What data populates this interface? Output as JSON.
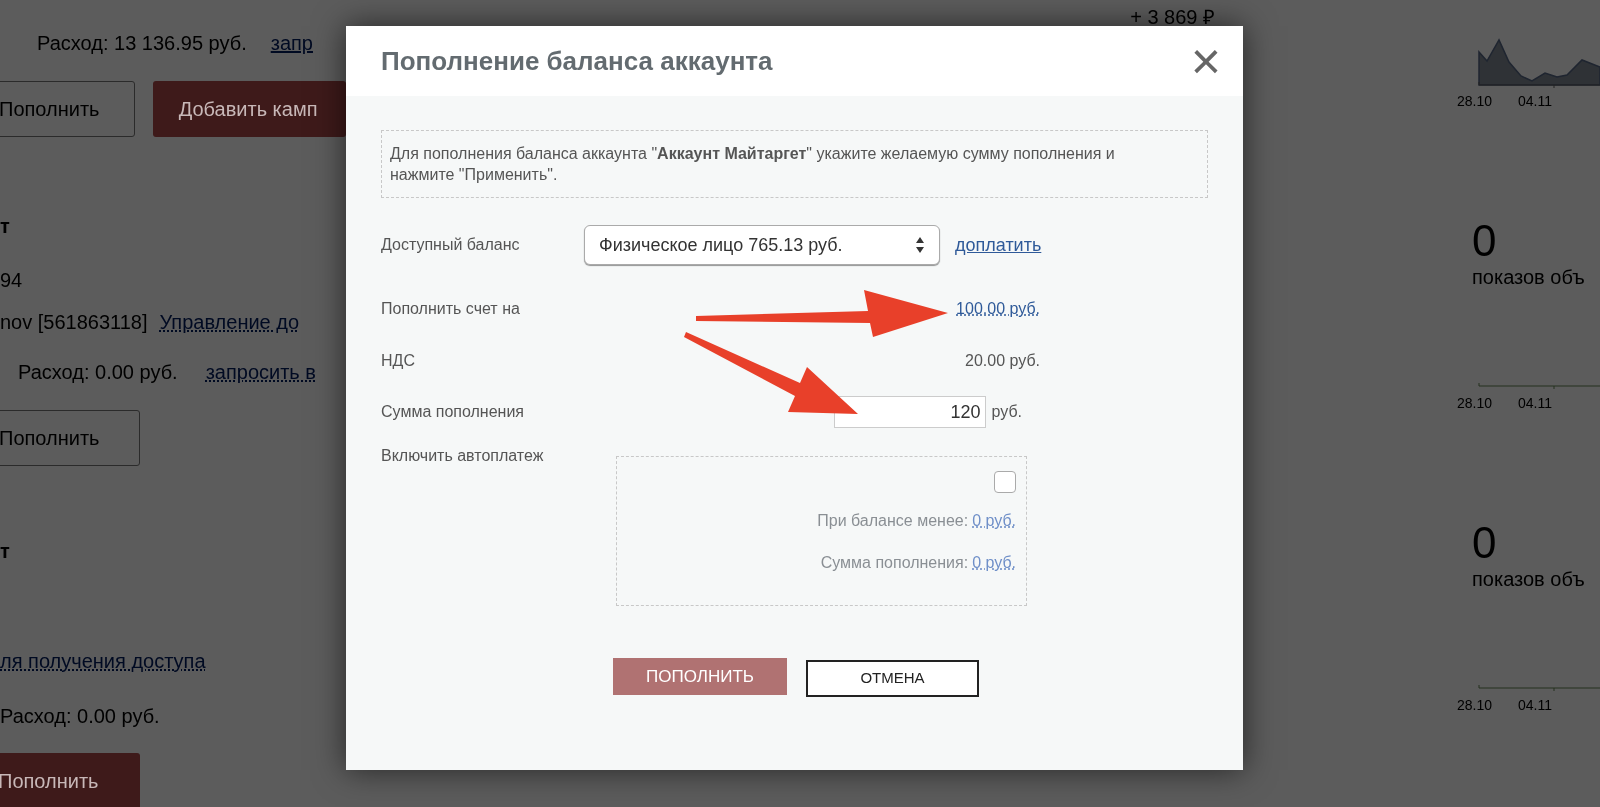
{
  "background": {
    "summary_line": {
      "spend": "Расход: 13 136.95 руб.",
      "link": "запр"
    },
    "top_buttons": {
      "topup": "Пополнить",
      "add_campaign": "Добавить камп"
    },
    "accounts": [
      {
        "heading": "т",
        "id_fragment": "94",
        "owner": "nov [561863118]",
        "manage_link": "Управление до",
        "spend": "Расход: 0.00 руб.",
        "request_link": "запросить в",
        "button": "Пополнить",
        "accent": false
      },
      {
        "heading": "т",
        "access_link": "ля получения доступа",
        "spend": "Расход: 0.00 руб.",
        "button": "Пополнить",
        "accent": true
      }
    ],
    "total": "+ 3 869 ₽",
    "stats": [
      {
        "kind": "line",
        "ticks": [
          "28.10",
          "04.11"
        ]
      },
      {
        "kind": "flat",
        "value": "0",
        "label": "показов объ",
        "ticks": [
          "28.10",
          "04.11"
        ]
      },
      {
        "kind": "flat",
        "value": "0",
        "label": "показов объ",
        "ticks": [
          "28.10",
          "04.11"
        ]
      }
    ]
  },
  "modal": {
    "title": "Пополнение баланса аккаунта",
    "close": "×",
    "info": "Для пополнения баланса аккаунта \"**Аккаунт Майтаргет**\" укажите желаемую сумму пополнения и нажмите \"Применить\".",
    "balance": {
      "label": "Доступный баланс",
      "select_value": "Физическое лицо 765.13 руб.",
      "link": "доплатить"
    },
    "topup": {
      "label": "Пополнить счет на",
      "value": "100.00 руб."
    },
    "vat": {
      "label": "НДС",
      "value": "20.00 руб."
    },
    "total": {
      "label": "Сумма пополнения",
      "value": "120",
      "unit": "руб."
    },
    "autopay": {
      "label": "Включить автоплатеж",
      "checked": false,
      "rows": [
        {
          "label": "При балансе менее:",
          "value": "0 руб."
        },
        {
          "label": "Сумма пополнения:",
          "value": "0 руб."
        }
      ]
    },
    "buttons": {
      "submit": "ПОПОЛНИТЬ",
      "cancel": "ОТМЕНА"
    }
  },
  "annotations": [
    {
      "kind": "arrow"
    },
    {
      "kind": "arrow"
    }
  ]
}
